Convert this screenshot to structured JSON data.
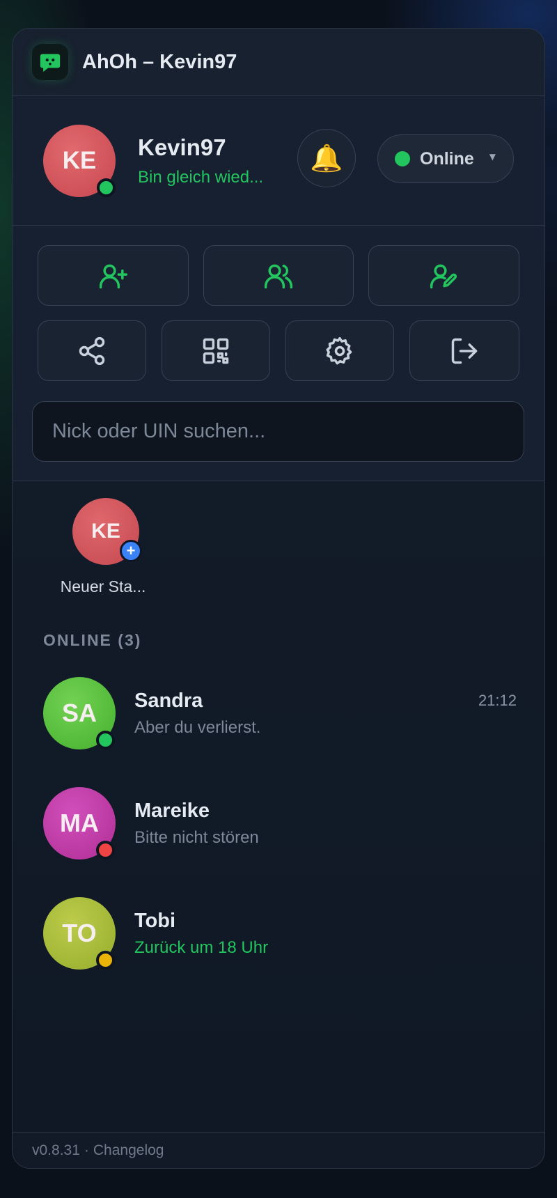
{
  "app": {
    "title": "AhOh – Kevin97",
    "logo_icon": "chat-bubble-icon",
    "accent": "#22c55e"
  },
  "profile": {
    "initials": "KE",
    "name": "Kevin97",
    "status_message": "Bin gleich wied...",
    "avatar_color": "#d9545c",
    "presence": "online",
    "bell_icon": "bell-icon",
    "status_select": {
      "label": "Online",
      "dot_color": "#22c55e"
    }
  },
  "actions": {
    "row1": [
      "add-user-icon",
      "users-icon",
      "edit-user-icon"
    ],
    "row2": [
      "share-icon",
      "qr-code-icon",
      "settings-icon",
      "logout-icon"
    ]
  },
  "search": {
    "placeholder": "Nick oder UIN suchen...",
    "value": ""
  },
  "story": {
    "initials": "KE",
    "label": "Neuer Sta...",
    "plus": "+"
  },
  "section": {
    "label": "ONLINE (3)"
  },
  "contacts": [
    {
      "initials": "SA",
      "name": "Sandra",
      "message": "Aber du verlierst.",
      "time": "21:12",
      "avatar_color": "#5cc241",
      "dot_color": "#22c55e"
    },
    {
      "initials": "MA",
      "name": "Mareike",
      "message": "Bitte nicht stören",
      "time": "",
      "avatar_color": "#c43aa8",
      "dot_color": "#ef4444"
    },
    {
      "initials": "TO",
      "name": "Tobi",
      "message": "Zurück um 18 Uhr",
      "time": "",
      "avatar_color": "#a8b93a",
      "dot_color": "#eab308"
    }
  ],
  "footer": {
    "version": "v0.8.31",
    "separator": "·",
    "changelog": "Changelog"
  }
}
